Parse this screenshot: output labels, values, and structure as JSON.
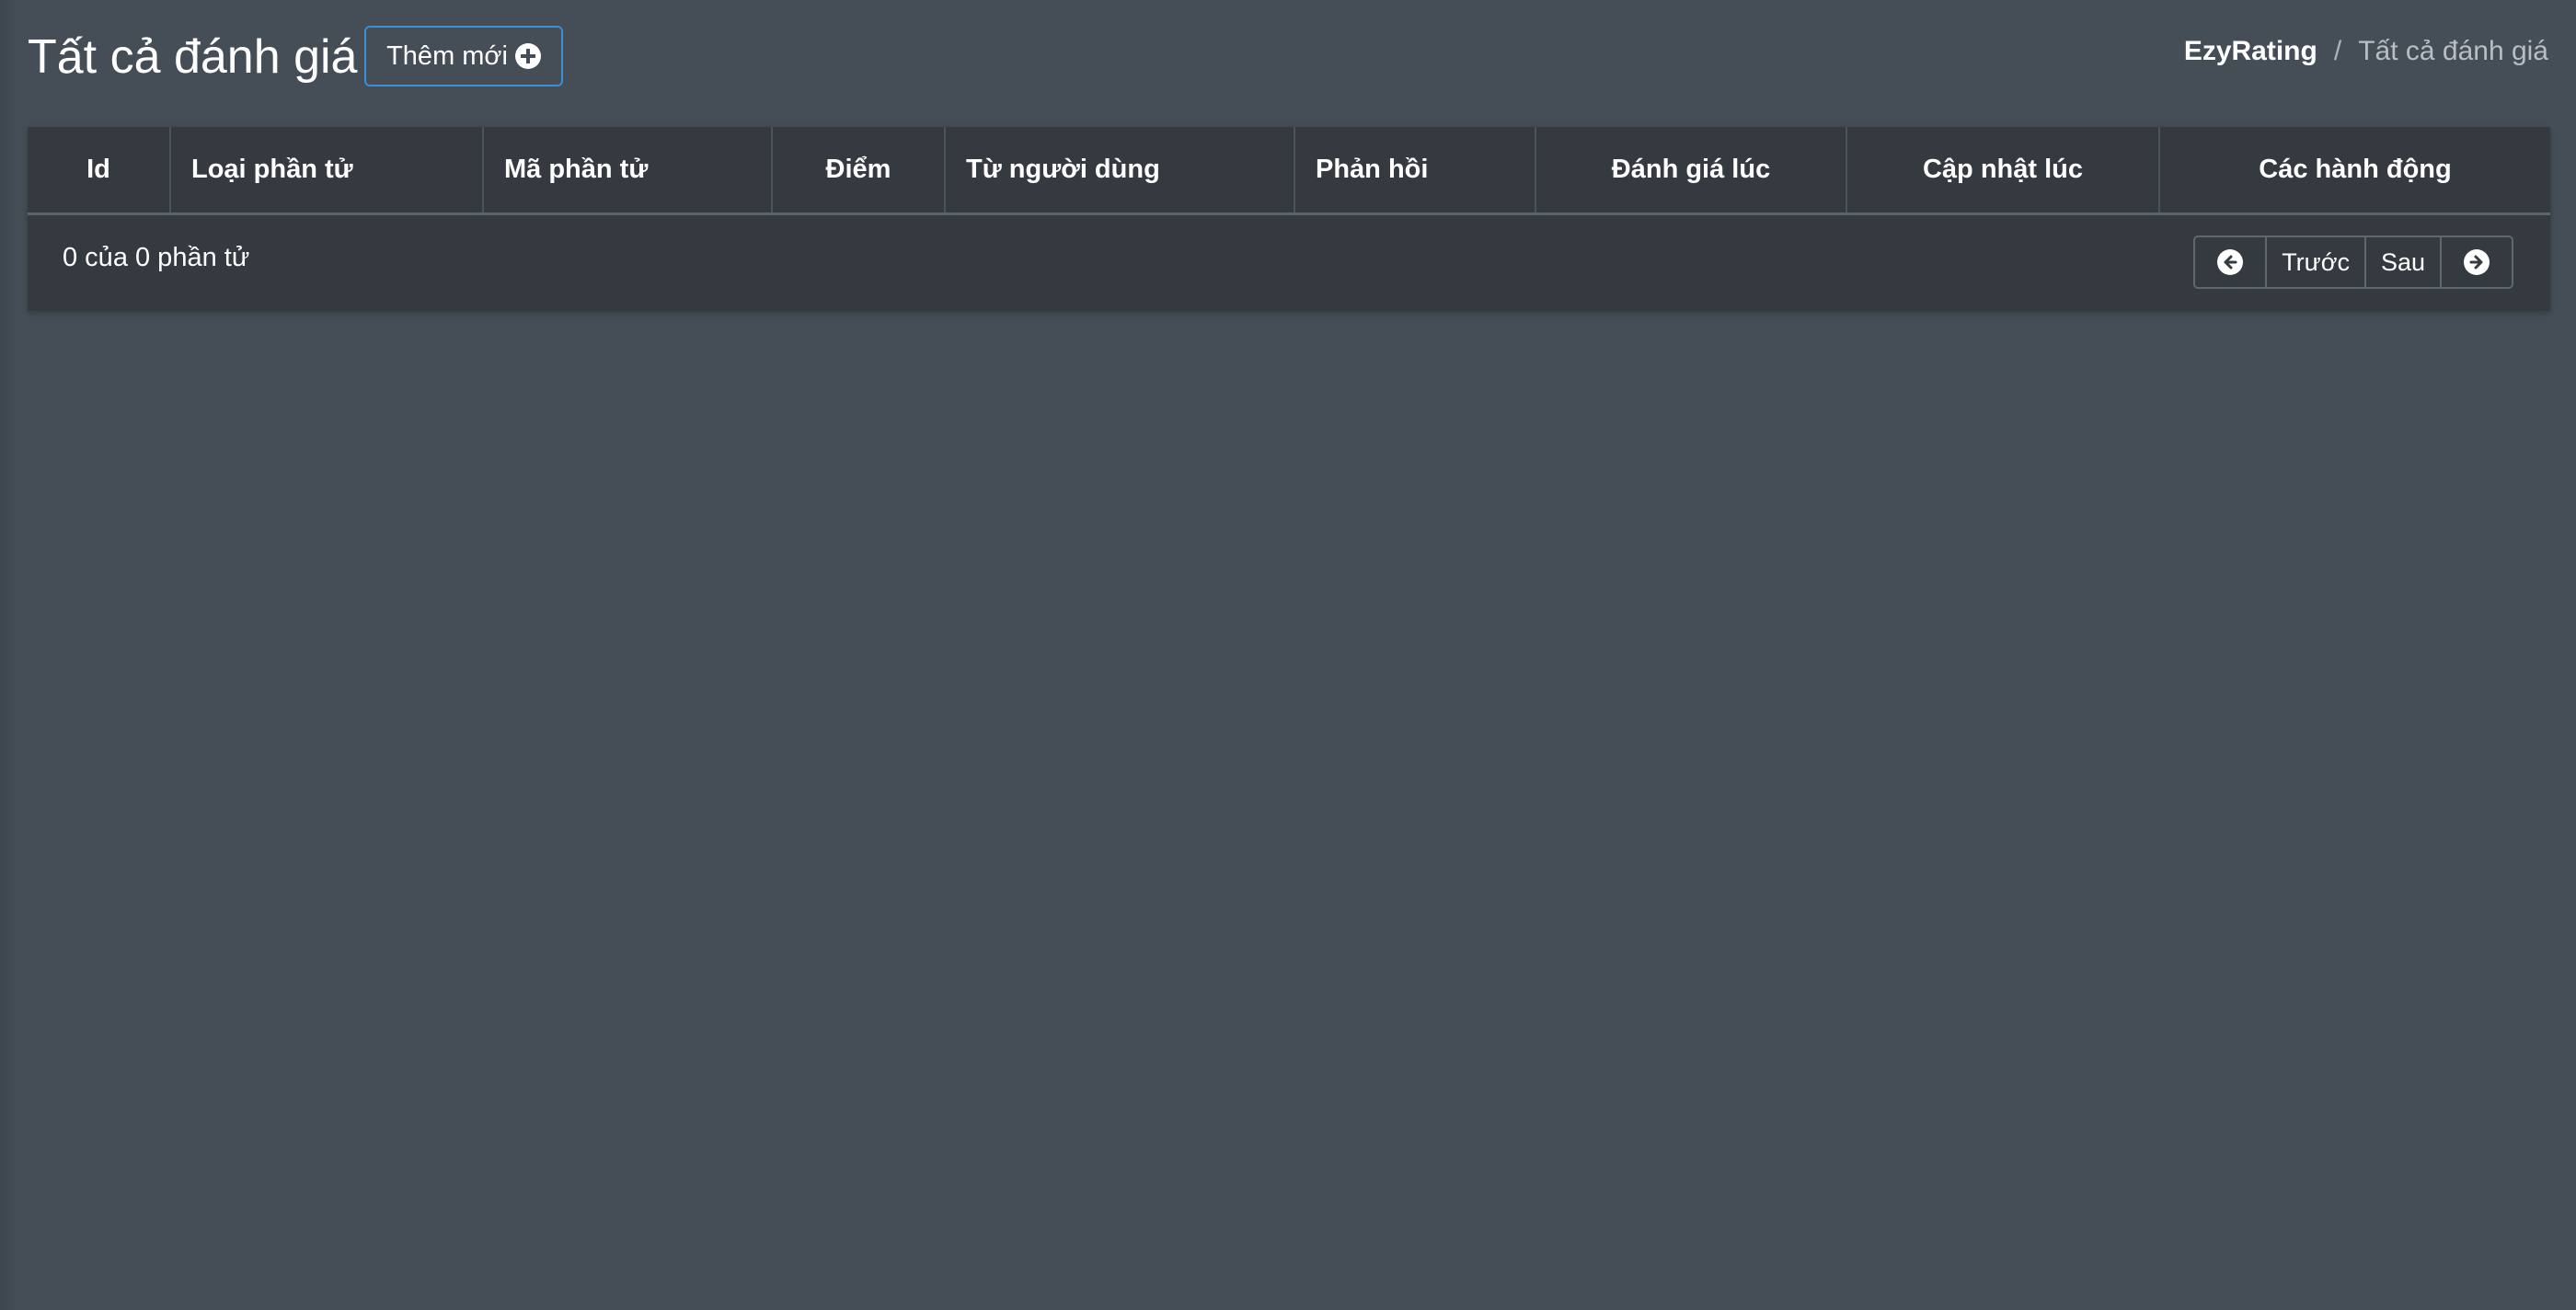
{
  "header": {
    "title": "Tất cả đánh giá",
    "add_button_label": "Thêm mới",
    "add_icon": "plus-circle-icon"
  },
  "breadcrumb": {
    "root": "EzyRating",
    "separator": "/",
    "current": "Tất cả đánh giá"
  },
  "table": {
    "columns": [
      "Id",
      "Loại phần tử",
      "Mã phần tử",
      "Điểm",
      "Từ người dùng",
      "Phản hồi",
      "Đánh giá lúc",
      "Cập nhật lúc",
      "Các hành động"
    ],
    "rows": []
  },
  "footer": {
    "count_text": "0 của 0 phần tử",
    "prev_label": "Trước",
    "next_label": "Sau",
    "prev_icon": "arrow-left-circle-icon",
    "next_icon": "arrow-right-circle-icon"
  },
  "colors": {
    "page_background": "#454d56",
    "card_background": "#343a40",
    "accent_border": "#3b8fd9",
    "text": "#ffffff"
  }
}
